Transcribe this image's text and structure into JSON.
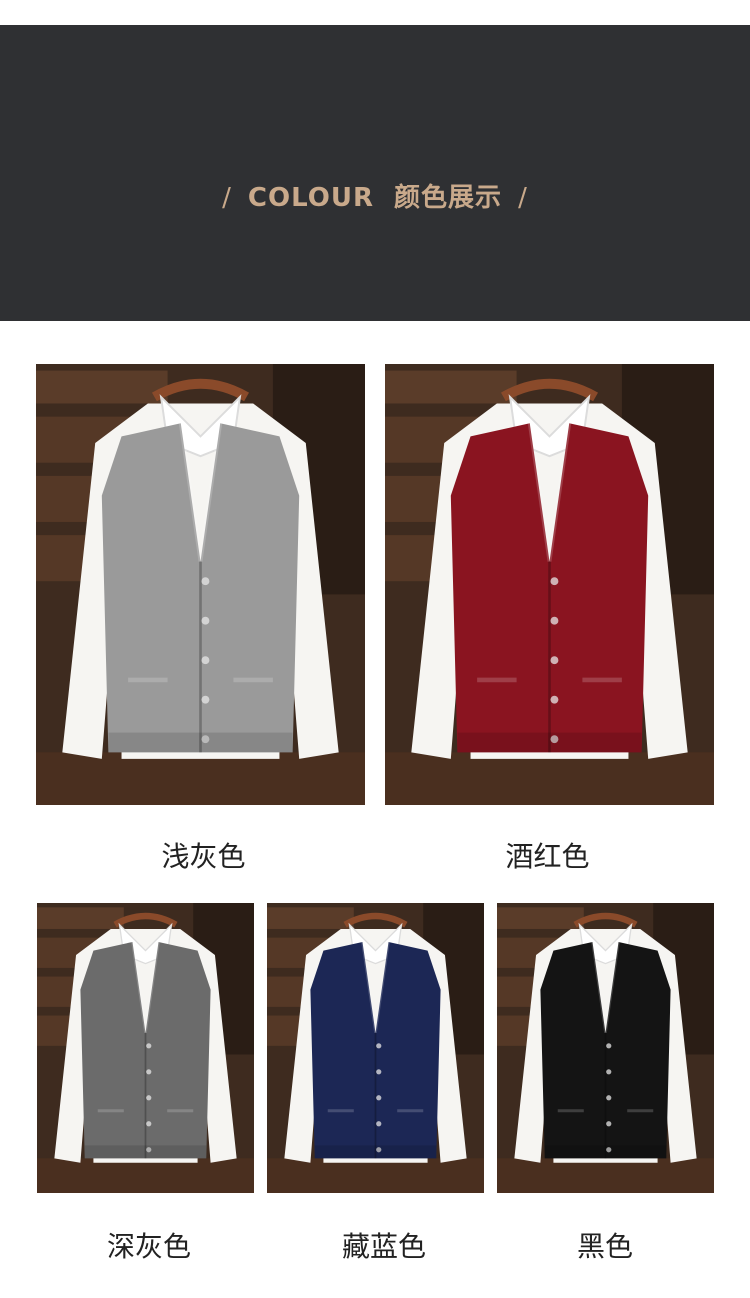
{
  "banner": {
    "slash_left": "/",
    "title_en": "COLOUR",
    "title_cn": "颜色展示",
    "slash_right": "/"
  },
  "colors": {
    "banner_bg": "#2f3033",
    "title": "#c9a98b"
  },
  "products": [
    {
      "label": "浅灰色",
      "vest_color": "#9a9a9a"
    },
    {
      "label": "酒红色",
      "vest_color": "#8a1420"
    },
    {
      "label": "深灰色",
      "vest_color": "#6b6b6b"
    },
    {
      "label": "藏蓝色",
      "vest_color": "#1c2755"
    },
    {
      "label": "黑色",
      "vest_color": "#141414"
    }
  ]
}
